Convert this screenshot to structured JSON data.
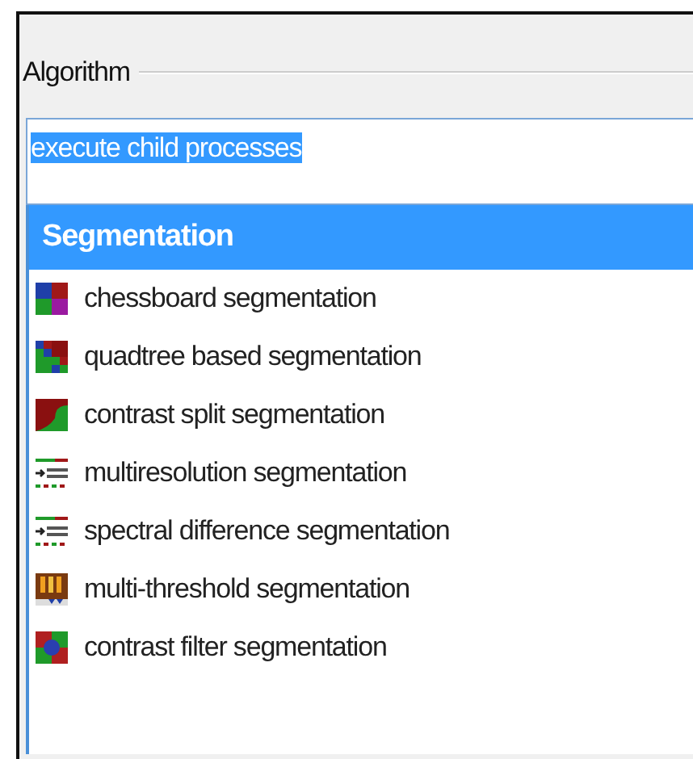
{
  "group": {
    "title": "Algorithm"
  },
  "field": {
    "value": "execute child processes",
    "selected_text": true
  },
  "list": {
    "category": {
      "label": "Segmentation",
      "selected": true
    },
    "items": [
      {
        "label": "chessboard segmentation",
        "kind": "chessboard",
        "selected": false
      },
      {
        "label": "quadtree based segmentation",
        "kind": "quadtree",
        "selected": false
      },
      {
        "label": "contrast split segmentation",
        "kind": "split",
        "selected": false
      },
      {
        "label": "multiresolution segmentation",
        "kind": "multires",
        "selected": false
      },
      {
        "label": "spectral difference segmentation",
        "kind": "multires",
        "selected": false
      },
      {
        "label": "multi-threshold segmentation",
        "kind": "threshold",
        "selected": false
      },
      {
        "label": "contrast filter segmentation",
        "kind": "filter",
        "selected": false
      }
    ]
  }
}
